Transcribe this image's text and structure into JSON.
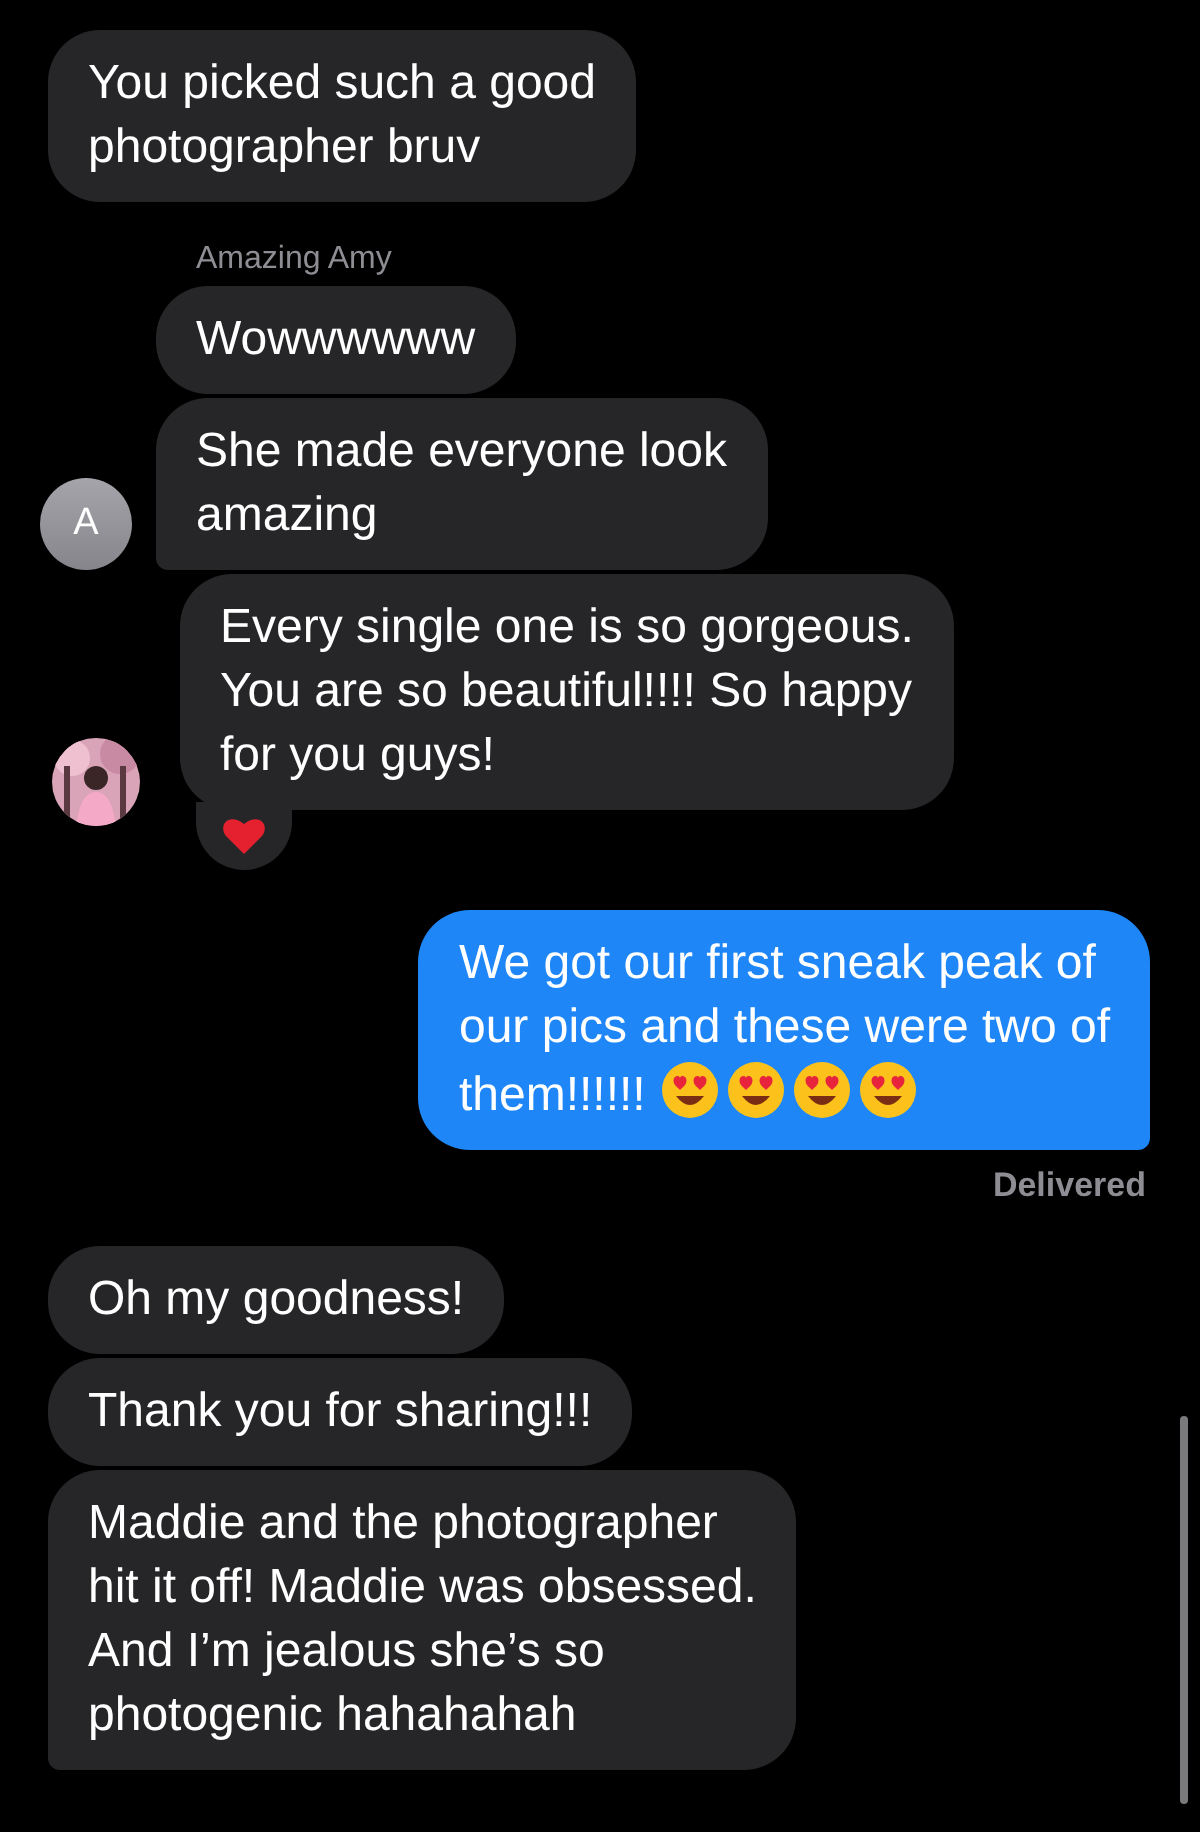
{
  "messages": [
    {
      "kind": "incoming",
      "text": "You picked such a good\nphotographer bruv",
      "tail": false
    },
    {
      "kind": "sender",
      "text": "Amazing Amy"
    },
    {
      "kind": "incoming",
      "text": "Wowwwwww",
      "tail": false
    },
    {
      "kind": "incoming",
      "text": "She made everyone look\namazing",
      "tail": true,
      "avatar": {
        "kind": "initial",
        "text": "A"
      }
    },
    {
      "kind": "incoming",
      "text": "Every single one is so gorgeous.\nYou are so beautiful!!!! So happy\nfor you guys!",
      "tail": false,
      "reaction": {
        "kind": "heart"
      }
    },
    {
      "kind": "outgoing",
      "text": "We got our first sneak peak of\nour pics and these were two of\nthem!!!!!! ",
      "tail": true,
      "emojis": [
        {
          "kind": "heart-eyes"
        },
        {
          "kind": "heart-eyes"
        },
        {
          "kind": "heart-eyes"
        },
        {
          "kind": "heart-eyes"
        }
      ]
    },
    {
      "kind": "status",
      "text": "Delivered"
    },
    {
      "kind": "incoming",
      "text": "Oh my goodness!",
      "tail": false
    },
    {
      "kind": "incoming",
      "text": "Thank you for sharing!!!",
      "tail": false
    },
    {
      "kind": "incoming",
      "text": "Maddie and the photographer\nhit it off! Maddie was obsessed.\nAnd I’m jealous she’s so\nphotogenic hahahahah",
      "tail": true
    }
  ]
}
